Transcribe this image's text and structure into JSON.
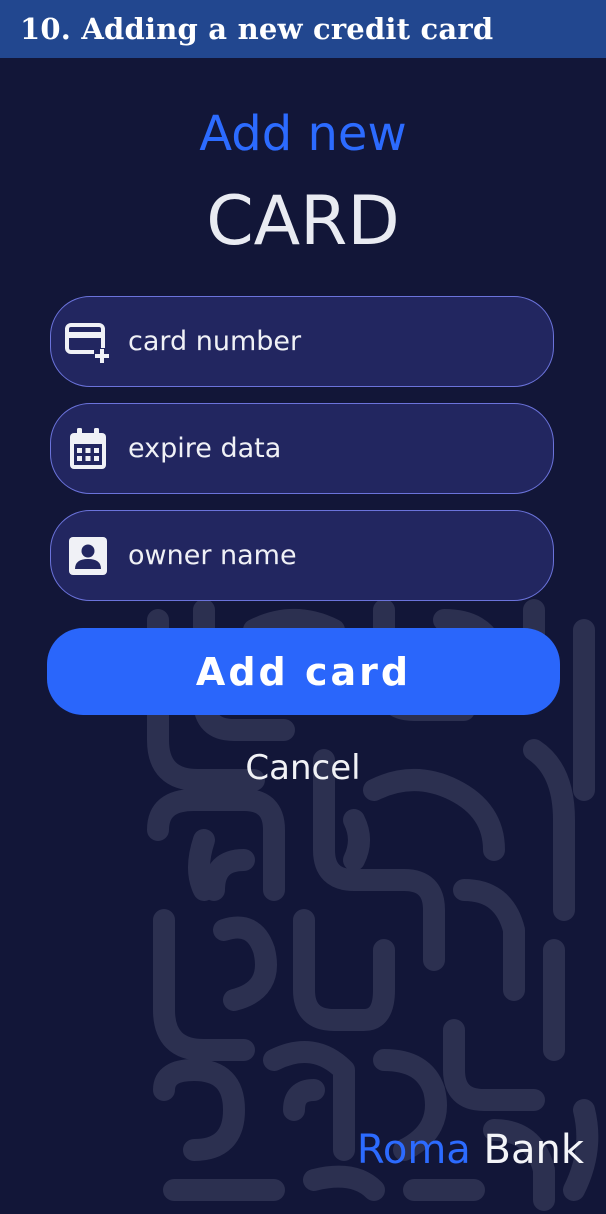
{
  "caption": {
    "text": "10. Adding a new credit card"
  },
  "heading": {
    "line1": "Add new",
    "line2": "CARD"
  },
  "form": {
    "fields": [
      {
        "placeholder": "card number",
        "icon": "add-card-icon"
      },
      {
        "placeholder": "expire data",
        "icon": "calendar-icon"
      },
      {
        "placeholder": "owner name",
        "icon": "person-badge-icon"
      }
    ],
    "submit_label": "Add card",
    "cancel_label": "Cancel"
  },
  "brand": {
    "part1": "Roma",
    "part2": "Bank"
  },
  "colors": {
    "background": "#121638",
    "caption_bar": "#22478f",
    "accent": "#2a66fb",
    "field_fill": "#222660",
    "field_border": "#6b73db",
    "pattern": "#2c3050"
  }
}
